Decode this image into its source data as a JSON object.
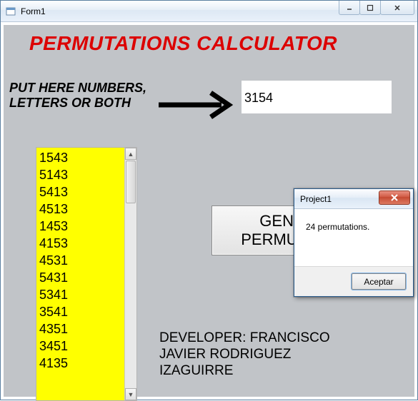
{
  "window": {
    "title": "Form1"
  },
  "heading": "PERMUTATIONS CALCULATOR",
  "instruction": "PUT HERE NUMBERS,\nLETTERS OR BOTH",
  "input_value": "3154",
  "generate_label": "GENERATE\nPERMUTATIONS",
  "developer_label": "DEVELOPER: FRANCISCO\nJAVIER RODRIGUEZ\nIZAGUIRRE",
  "permutations": [
    "1543",
    "5143",
    "5413",
    "4513",
    "1453",
    "4153",
    "4531",
    "5431",
    "5341",
    "3541",
    "4351",
    "3451",
    "4135"
  ],
  "dialog": {
    "title": "Project1",
    "message": "24 permutations.",
    "ok_label": "Aceptar"
  }
}
